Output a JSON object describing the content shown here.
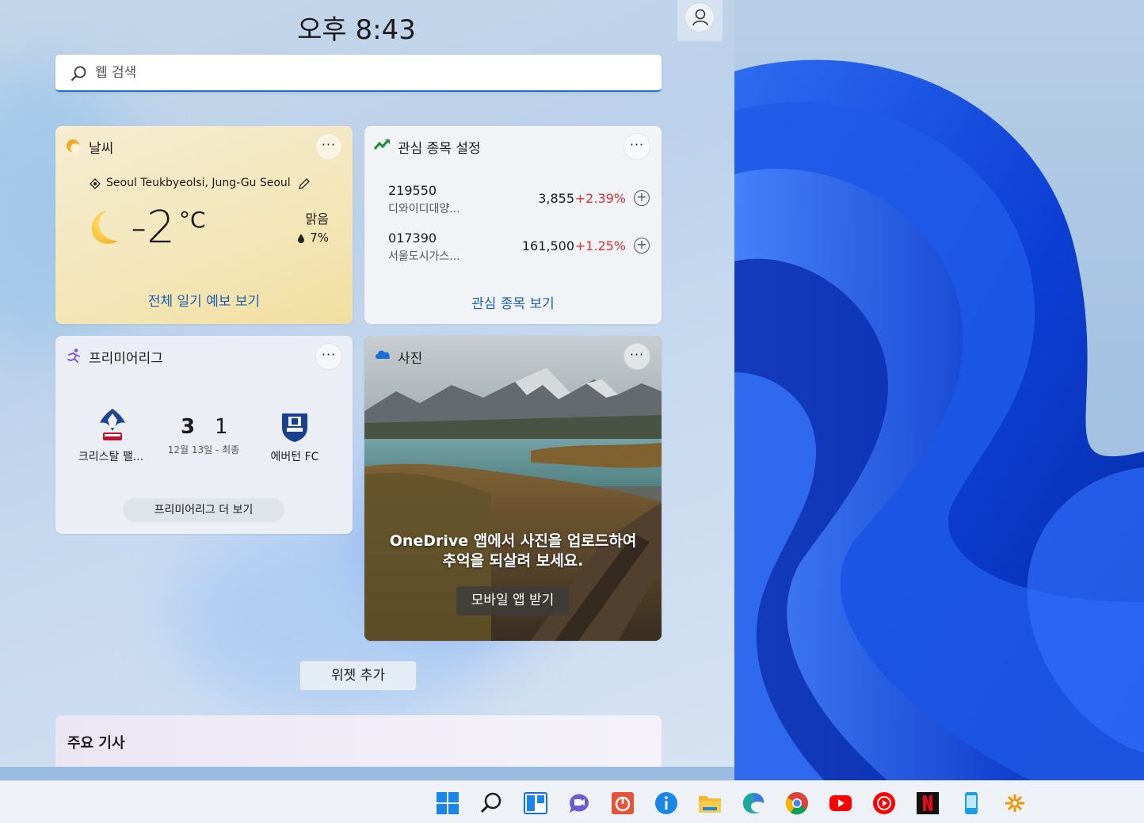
{
  "header": {
    "time": "오후 8:43"
  },
  "search": {
    "placeholder": "웹 검색"
  },
  "weather": {
    "title": "날씨",
    "location": "Seoul Teukbyeolsi, Jung-Gu Seoul",
    "temperature": "-2",
    "unit": "°C",
    "condition": "맑음",
    "precipitation": "7%",
    "link": "전체 일기 예보 보기"
  },
  "stocks": {
    "title": "관심 종목 설정",
    "rows": [
      {
        "symbol": "219550",
        "name": "디와이디대양...",
        "price": "3,855",
        "change": "+2.39%"
      },
      {
        "symbol": "017390",
        "name": "서울도시가스...",
        "price": "161,500",
        "change": "+1.25%"
      }
    ],
    "link": "관심 종목 보기"
  },
  "sports": {
    "title": "프리미어리그",
    "home_team": "크리스탈 팰...",
    "away_team": "에버턴 FC",
    "home_score": "3",
    "away_score": "1",
    "date": "12월 13일 - 최종",
    "more": "프리미어리그 더 보기"
  },
  "photos": {
    "title": "사진",
    "message": "OneDrive 앱에서 사진을 업로드하여 추억을 되살려 보세요.",
    "button": "모바일 앱 받기"
  },
  "add_widget": "위젯 추가",
  "top_stories": {
    "title": "주요 기사"
  },
  "colors": {
    "accent": "#1a5fb4",
    "positive_change": "#d13438"
  },
  "taskbar": {
    "icons": [
      "start-icon",
      "search-icon",
      "widgets-icon",
      "teams-chat-icon",
      "app-red-icon",
      "info-icon",
      "file-explorer-icon",
      "edge-icon",
      "chrome-icon",
      "youtube-icon",
      "youtube-music-icon",
      "netflix-icon",
      "phone-link-icon",
      "app-orange-icon"
    ]
  }
}
